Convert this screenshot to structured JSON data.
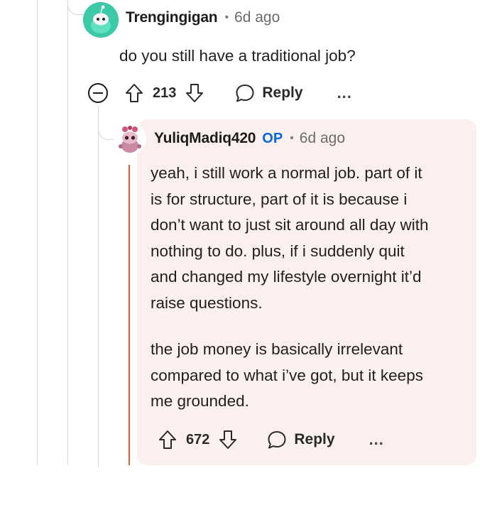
{
  "comment": {
    "username": "Trengingigan",
    "time": "6d ago",
    "text": "do you still have a traditional job?",
    "upvotes": "213",
    "reply_label": "Reply",
    "more_label": "..."
  },
  "reply": {
    "username": "YuliqMadiq420",
    "op_badge": "OP",
    "time": "6d ago",
    "paragraph1": [
      "yeah, i still work a normal job. part of it",
      "is for structure, part of it is because i",
      "don’t want to just sit around all day with",
      "nothing to do. plus, if i suddenly quit",
      "and changed my lifestyle overnight it’d",
      "raise questions."
    ],
    "paragraph2": [
      "the job money is basically irrelevant",
      "compared to what i’ve got, but it keeps",
      "me grounded."
    ],
    "upvotes": "672",
    "reply_label": "Reply",
    "more_label": "..."
  },
  "colors": {
    "accent_op": "#e65a2f",
    "op_badge": "#0a66d9",
    "reply_background": "#fbf0ed",
    "avatar_teal": "#3cc9a8"
  },
  "icons": {
    "collapse": "minus-circle-icon",
    "upvote": "arrow-up-outline-icon",
    "downvote": "arrow-down-outline-icon",
    "reply": "speech-bubble-icon",
    "avatar_reply": "snoo-pink-avatar"
  }
}
